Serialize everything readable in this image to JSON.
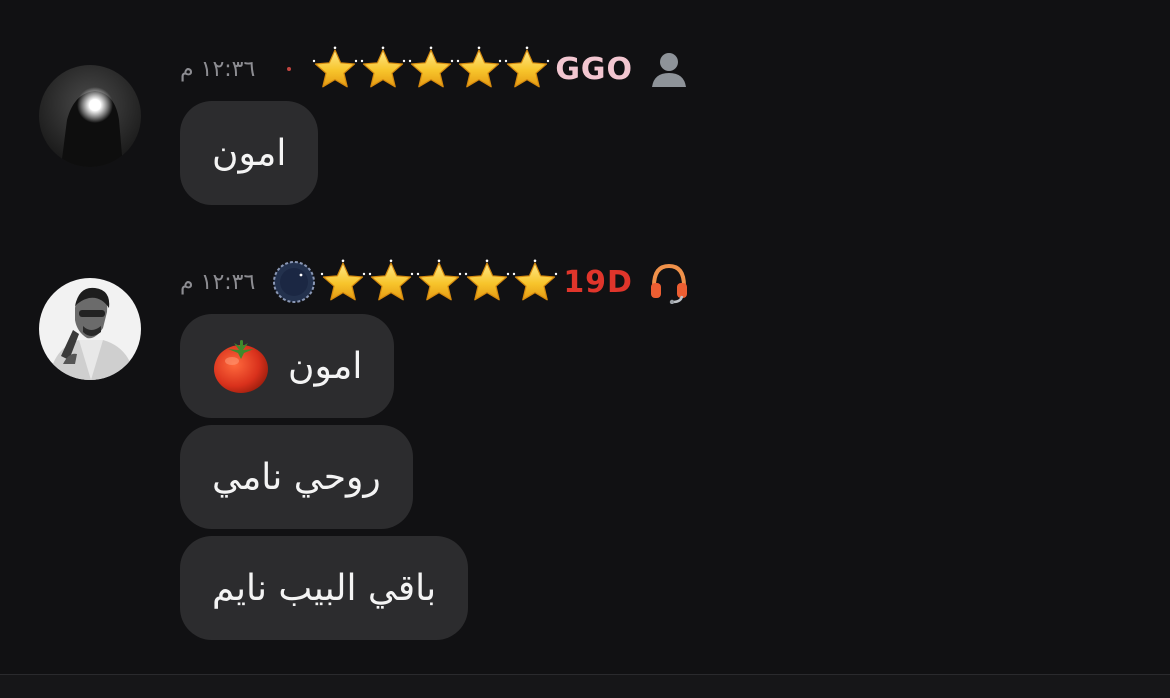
{
  "messages": [
    {
      "sender": "GGO",
      "sender_color": "#f2c6d0",
      "time": "١٢:٣٦ م",
      "stars": 5,
      "bubbles": [
        "امون"
      ]
    },
    {
      "sender": "19D",
      "sender_color": "#e0352b",
      "time": "١٢:٣٦ م",
      "stars": 5,
      "bubbles": [
        "امون",
        "روحي نامي",
        "باقي البيب نايم"
      ]
    }
  ],
  "icons": {
    "star": "star-icon",
    "user": "person-silhouette-icon",
    "headset": "headphones-icon",
    "moon": "crescent-moon-badge-icon",
    "tomato": "tomato-emoji"
  },
  "colors": {
    "background": "#111113",
    "bubble": "#2c2c2e",
    "timestamp": "#8d8d92",
    "star": "#f7c52c"
  }
}
